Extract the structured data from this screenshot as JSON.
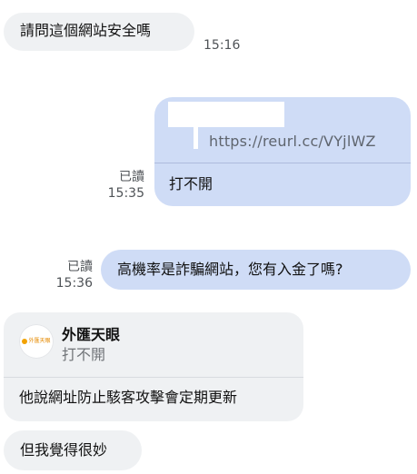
{
  "messages": [
    {
      "direction": "incoming",
      "text": "請問這個網站安全嗎",
      "timestamp": "15:16"
    },
    {
      "direction": "outgoing",
      "link": "https://reurl.cc/VYjlWZ",
      "caption": "打不開",
      "read": "已讀",
      "timestamp": "15:35"
    },
    {
      "direction": "outgoing",
      "text": "高機率是詐騙網站，您有入金了嗎?",
      "read": "已讀",
      "timestamp": "15:36"
    },
    {
      "direction": "incoming",
      "card": {
        "name": "外匯天眼",
        "quoted": "打不開",
        "reply": "他說網址防止駭客攻擊會定期更新",
        "logo_text": "外匯天眼"
      }
    },
    {
      "direction": "incoming",
      "text": "但我覺得很妙"
    }
  ],
  "colors": {
    "incoming_bubble": "#eff1f3",
    "outgoing_bubble": "#cfdcf6",
    "logo_accent": "#f2a200"
  }
}
